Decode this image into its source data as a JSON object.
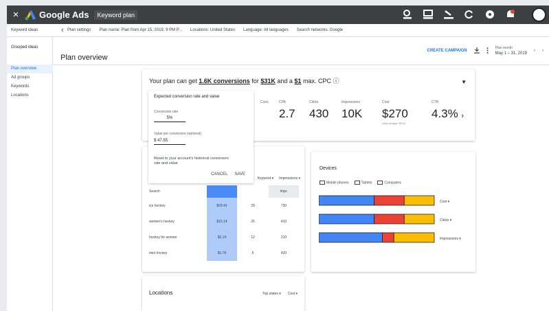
{
  "topbar": {
    "close": "×",
    "product": "Google Ads",
    "page": "Keyword plan"
  },
  "crumbbar": {
    "left_label": "Keyword ideas",
    "back": "‹",
    "items": [
      "Plan settings",
      "Plan name: Plan from Apr 15, 2019, 9 PM P...",
      "Locations: United States",
      "Language: All languages",
      "Search networks: Google"
    ]
  },
  "leftnav": {
    "group_label": "Grouped ideas",
    "items": [
      {
        "label": "Plan overview",
        "active": true
      },
      {
        "label": "Ad groups",
        "active": false
      },
      {
        "label": "Keywords",
        "active": false
      },
      {
        "label": "Locations",
        "active": false
      }
    ]
  },
  "main": {
    "title": "Plan overview",
    "create_campaign": "CREATE CAMPAIGN",
    "date_label": "Plan month",
    "date_value": "May 1 – 31, 2019",
    "nav_prev": "‹",
    "nav_next": "›"
  },
  "summary": {
    "headline_pre": "Your plan can get",
    "conversions": "1.6K conversions",
    "for_text": "for",
    "cost": "$31K",
    "and_text": "and a",
    "cpc": "$1",
    "max_text": "max. CPC",
    "metrics": [
      {
        "label": "Conv.",
        "value": "",
        "sub": ""
      },
      {
        "label": "CPA",
        "value": "2.7",
        "sub": ""
      },
      {
        "label": "Clicks",
        "value": "430",
        "sub": ""
      },
      {
        "label": "Impressions",
        "value": "10K",
        "sub": ""
      },
      {
        "label": "Cost",
        "value": "$270",
        "sub": "Daily budget: $9.00"
      },
      {
        "label": "CTR",
        "value": "4.3%",
        "sub": ""
      }
    ]
  },
  "popup": {
    "title": "Expected conversion rate and value",
    "f1_label": "Conversion rate",
    "f1_value": "5%",
    "f2_label": "Value per conversion (optional)",
    "f2_value": "$ 47.55",
    "reset": "Reset to your account's historical conversion rate and value",
    "cancel": "CANCEL",
    "save": "SAVE"
  },
  "table": {
    "filter1": "Keyword",
    "filter2": "Impressions",
    "head": {
      "c0": "Search",
      "c1": "",
      "c2": "",
      "c3": "Impr."
    },
    "rows": [
      {
        "name": "ice hockey",
        "v1": "$29.41",
        "v2": "29",
        "v3": "730"
      },
      {
        "name": "women's hockey",
        "v1": "$15.14",
        "v2": "25",
        "v3": "410"
      },
      {
        "name": "hockey for women",
        "v1": "$2.14",
        "v2": "12",
        "v3": "210"
      },
      {
        "name": "mini hockey",
        "v1": "$1.76",
        "v2": "5",
        "v3": "420"
      }
    ]
  },
  "devices": {
    "title": "Devices",
    "legend": [
      "Mobile phones",
      "Tablets",
      "Computers"
    ],
    "colors": {
      "mobile": "#4285f4",
      "tablet": "#ea4335",
      "computer": "#fbbc04"
    },
    "rows": [
      {
        "label": "Cost",
        "mobile": 0.48,
        "tablet": 0.26,
        "computer": 0.26
      },
      {
        "label": "Clicks",
        "mobile": 0.48,
        "tablet": 0.26,
        "computer": 0.26
      },
      {
        "label": "Impressions",
        "mobile": 0.55,
        "tablet": 0.1,
        "computer": 0.35
      }
    ]
  },
  "locations": {
    "title": "Locations",
    "filter1": "Top states",
    "filter2": "Cost"
  }
}
